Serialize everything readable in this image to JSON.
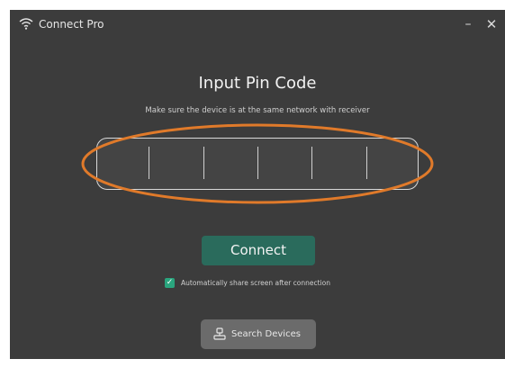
{
  "window": {
    "title": "Connect Pro",
    "minimize_symbol": "–",
    "close_symbol": "✕",
    "app_icon": "wifi-icon"
  },
  "pin": {
    "heading": "Input Pin Code",
    "subtitle": "Make sure the device is at the same network with receiver",
    "digit_count": 6,
    "values": [
      "",
      "",
      "",
      "",
      "",
      ""
    ]
  },
  "actions": {
    "connect_label": "Connect",
    "auto_share_label": "Automatically share screen after connection",
    "auto_share_checked": true,
    "search_label": "Search Devices",
    "search_icon": "device-search-icon"
  },
  "colors": {
    "background": "#3c3c3c",
    "connect": "#2a6b5c",
    "checkbox": "#2aa57e",
    "search": "#6b6b6b",
    "highlight": "#e07a2a"
  }
}
